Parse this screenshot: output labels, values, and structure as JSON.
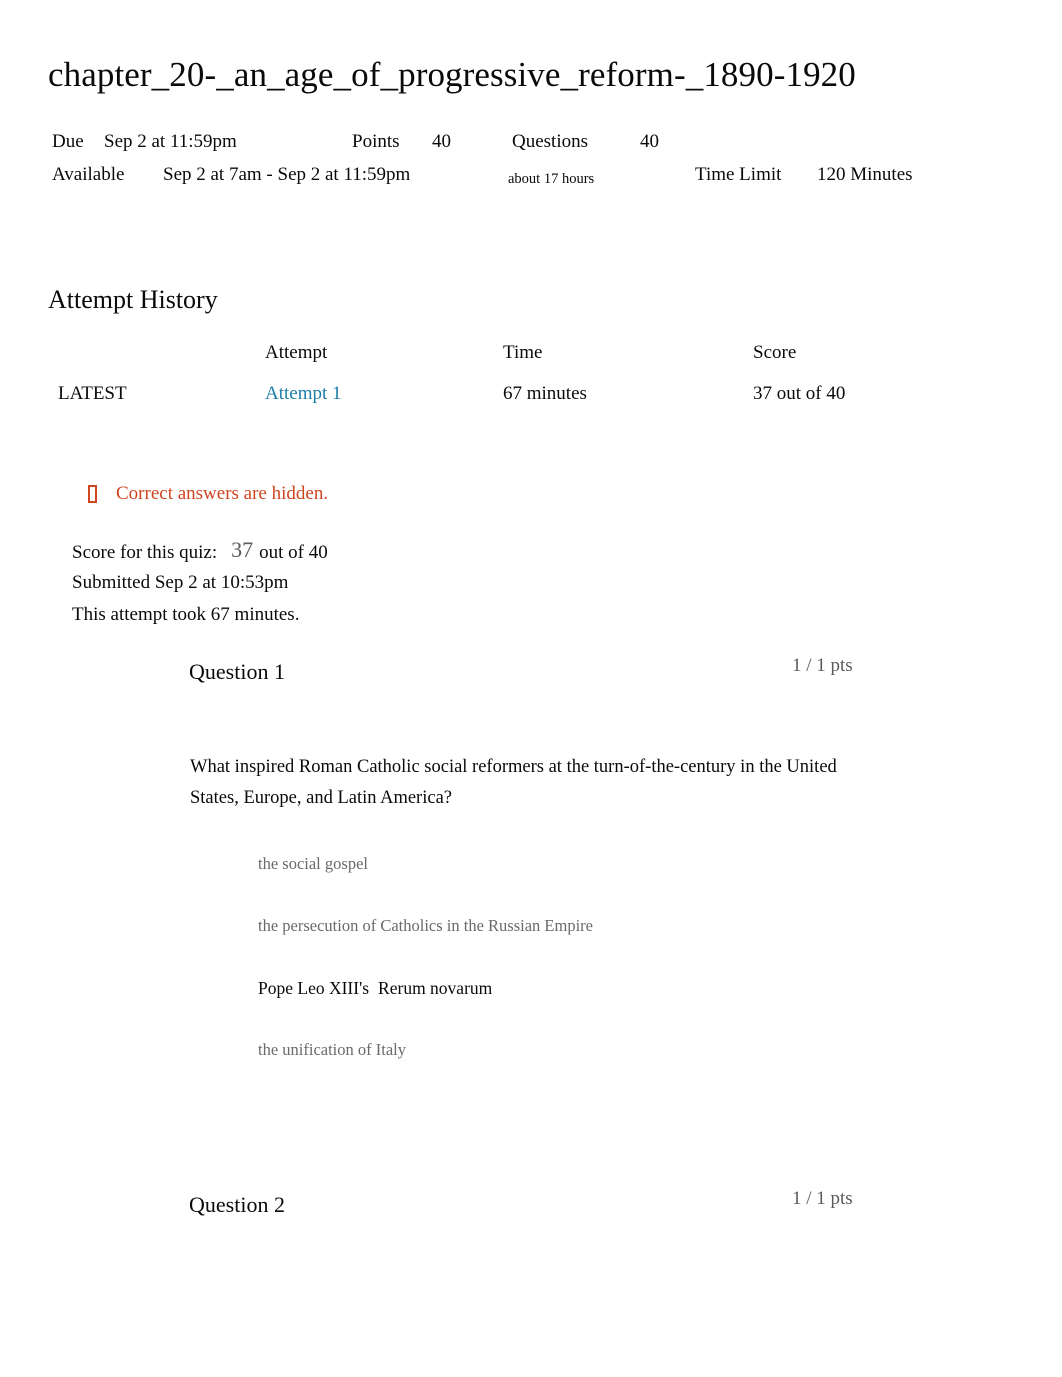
{
  "quiz": {
    "title": "chapter_20-_an_age_of_progressive_reform-_1890-1920",
    "meta": {
      "due_label": "Due",
      "due_value": "Sep 2 at 11:59pm",
      "points_label": "Points",
      "points_value": "40",
      "questions_label": "Questions",
      "questions_value": "40",
      "available_label": "Available",
      "available_value": "Sep 2 at 7am - Sep 2 at 11:59pm",
      "available_duration": "about 17 hours",
      "time_limit_label": "Time Limit",
      "time_limit_value": "120 Minutes"
    }
  },
  "attempt_history": {
    "heading": "Attempt History",
    "columns": {
      "blank": "",
      "attempt": "Attempt",
      "time": "Time",
      "score": "Score"
    },
    "rows": [
      {
        "marker": "LATEST",
        "attempt": "Attempt 1",
        "time": "67 minutes",
        "score": "37 out of 40"
      }
    ]
  },
  "result": {
    "hidden_notice": "Correct answers are hidden.",
    "hidden_notice_icon": "warning-tofu-icon",
    "hidden_notice_color": "#cf4520",
    "score_label": "Score for this quiz:",
    "score_value": "37",
    "score_suffix": "out of 40",
    "submitted": "Submitted Sep 2 at 10:53pm",
    "duration": "This attempt took 67 minutes."
  },
  "questions": [
    {
      "name": "Question 1",
      "points": "1 / 1 pts",
      "text": "What inspired Roman Catholic social reformers at the turn-of-the-century in the United States, Europe, and Latin America?",
      "answers": [
        {
          "text": "the social gospel",
          "selected": false
        },
        {
          "text": "the persecution of Catholics in the Russian Empire",
          "selected": false
        },
        {
          "text": "Pope Leo XIII's",
          "emphasis": "Rerum novarum",
          "selected": true
        },
        {
          "text": "the unification of Italy",
          "selected": false
        }
      ]
    },
    {
      "name": "Question 2",
      "points": "1 / 1 pts",
      "text": "",
      "answers": []
    }
  ],
  "colors": {
    "link": "#1d7ea8",
    "warning": "#cf4520",
    "muted": "#6a6a6a",
    "text": "#0a0a0a"
  }
}
